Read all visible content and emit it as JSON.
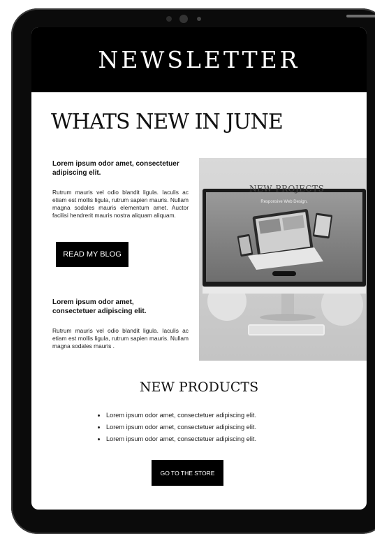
{
  "header": {
    "title": "NEWSLETTER"
  },
  "main": {
    "title": "WHATS NEW IN JUNE",
    "article1": {
      "heading": "Lorem ipsum odor amet, consectetuer adipiscing elit.",
      "body": "Rutrum mauris vel odio blandit ligula. Iaculis ac etiam est mollis ligula, rutrum sapien mauris. Nullam magna sodales mauris elementum amet. Auctor facilisi hendrerit mauris nostra aliquam aliquam.",
      "button_label": "READ MY BLOG"
    },
    "article2": {
      "heading": "Lorem ipsum odor amet, consectetuer adipiscing elit.",
      "body": "Rutrum mauris vel odio blandit ligula. Iaculis ac etiam est mollis ligula, rutrum sapien mauris. Nullam magna sodales mauris ."
    },
    "hero": {
      "label": "NEW PROJECTS",
      "screen_text": "Responsive Web Design."
    }
  },
  "products": {
    "title": "NEW PRODUCTS",
    "items": [
      "Lorem ipsum odor amet, consectetuer adipiscing elit.",
      "Lorem ipsum odor amet, consectetuer adipiscing elit.",
      "Lorem ipsum odor amet, consectetuer adipiscing elit."
    ],
    "button_label": "GO TO THE STORE"
  }
}
